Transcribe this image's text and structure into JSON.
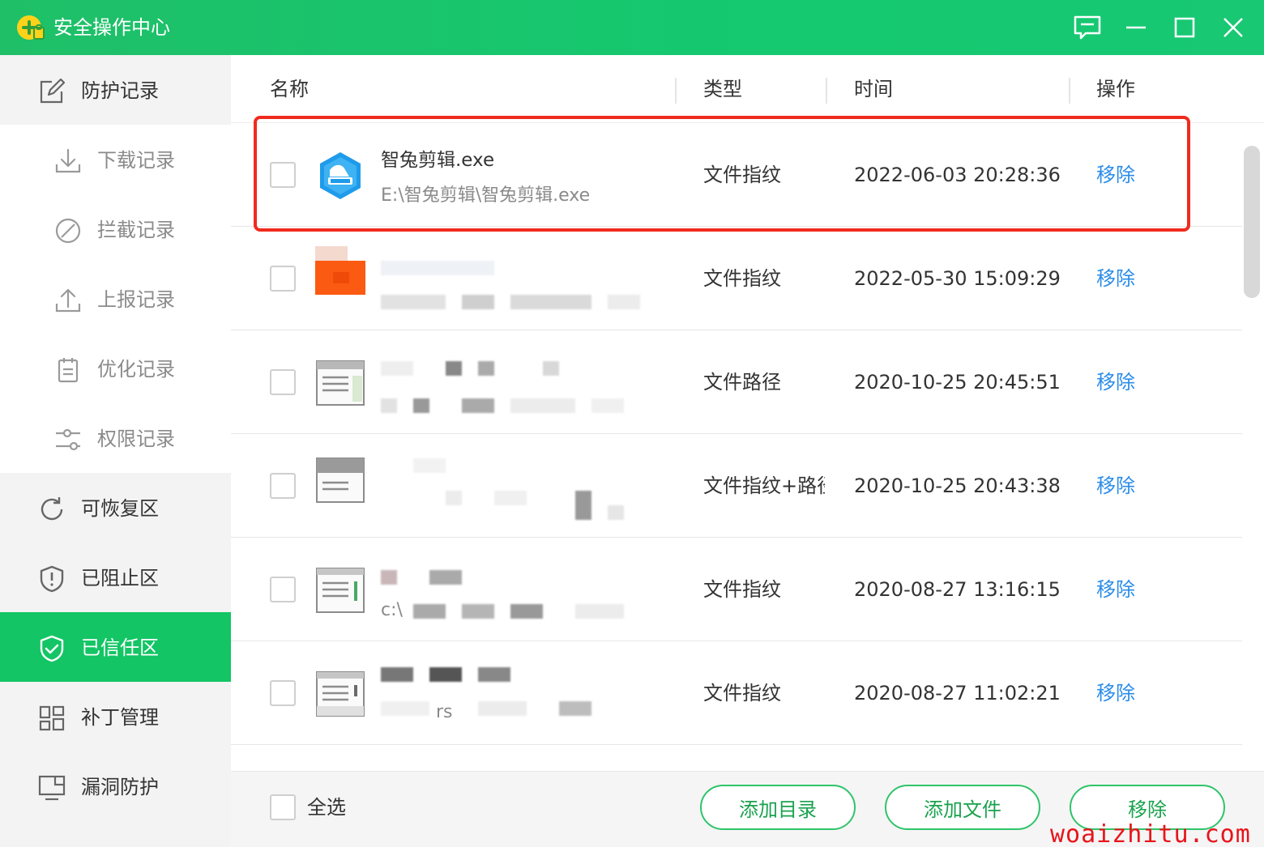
{
  "window": {
    "title": "安全操作中心",
    "controls": [
      "feedback-icon",
      "minimize-icon",
      "maximize-icon",
      "close-icon"
    ]
  },
  "sidebar": {
    "items": [
      {
        "label": "防护记录",
        "icon": "edit-icon",
        "kind": "section"
      },
      {
        "label": "下载记录",
        "icon": "download-icon",
        "kind": "sub"
      },
      {
        "label": "拦截记录",
        "icon": "block-icon",
        "kind": "sub"
      },
      {
        "label": "上报记录",
        "icon": "upload-icon",
        "kind": "sub"
      },
      {
        "label": "优化记录",
        "icon": "clipboard-icon",
        "kind": "sub"
      },
      {
        "label": "权限记录",
        "icon": "sliders-icon",
        "kind": "sub"
      },
      {
        "label": "可恢复区",
        "icon": "refresh-icon",
        "kind": "section"
      },
      {
        "label": "已阻止区",
        "icon": "shield-alert-icon",
        "kind": "section"
      },
      {
        "label": "已信任区",
        "icon": "shield-check-icon",
        "kind": "section",
        "active": true
      },
      {
        "label": "补丁管理",
        "icon": "grid-icon",
        "kind": "section"
      },
      {
        "label": "漏洞防护",
        "icon": "monitor-icon",
        "kind": "section"
      }
    ]
  },
  "table": {
    "headers": {
      "name": "名称",
      "type": "类型",
      "time": "时间",
      "action": "操作"
    },
    "rows": [
      {
        "name": "智兔剪辑.exe",
        "path": "E:\\智兔剪辑\\智兔剪辑.exe",
        "type": "文件指纹",
        "time": "2022-06-03 20:28:36",
        "action": "移除"
      },
      {
        "name": "",
        "path": "",
        "type": "文件指纹",
        "time": "2022-05-30 15:09:29",
        "action": "移除"
      },
      {
        "name": "",
        "path": "",
        "type": "文件路径",
        "time": "2020-10-25 20:45:51",
        "action": "移除"
      },
      {
        "name": "",
        "path": "",
        "type": "文件指纹+路径",
        "time": "2020-10-25 20:43:38",
        "action": "移除"
      },
      {
        "name": "",
        "path": "c:\\",
        "type": "文件指纹",
        "time": "2020-08-27 13:16:15",
        "action": "移除"
      },
      {
        "name": "",
        "path": "rs",
        "type": "文件指纹",
        "time": "2020-08-27 11:02:21",
        "action": "移除"
      }
    ]
  },
  "footer": {
    "select_all": "全选",
    "add_dir": "添加目录",
    "add_file": "添加文件",
    "remove": "移除"
  },
  "watermark": "woaizhitu.com",
  "colors": {
    "brand_green": "#13c564",
    "link_blue": "#2a8ce8",
    "highlight_red": "#f02b1e"
  }
}
